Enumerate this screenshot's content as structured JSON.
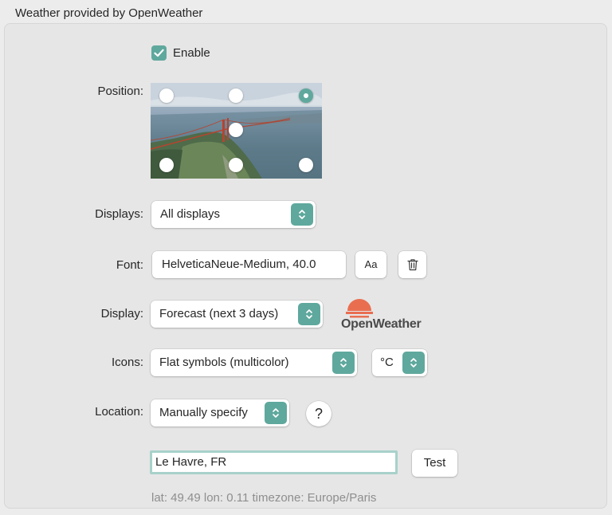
{
  "section_title": "Weather provided by OpenWeather",
  "enable": {
    "label": "Enable",
    "checked": true
  },
  "position": {
    "label": "Position:",
    "selected": "top-right",
    "options": [
      "top-left",
      "top-center",
      "top-right",
      "center",
      "bottom-left",
      "bottom-center",
      "bottom-right"
    ]
  },
  "displays": {
    "label": "Displays:",
    "value": "All displays"
  },
  "font": {
    "label": "Font:",
    "value": "HelveticaNeue-Medium, 40.0",
    "font_button": "Aa"
  },
  "display": {
    "label": "Display:",
    "value": "Forecast (next 3 days)"
  },
  "brand": {
    "name": "OpenWeather",
    "color": "#e96e50"
  },
  "icons": {
    "label": "Icons:",
    "value": "Flat symbols (multicolor)",
    "unit": "°C"
  },
  "location": {
    "label": "Location:",
    "value": "Manually specify",
    "help": "?",
    "city": "Le Havre, FR",
    "test_button": "Test",
    "info": "lat: 49.49 lon: 0.11 timezone: Europe/Paris"
  },
  "colors": {
    "accent": "#5fa89d",
    "focus_ring": "#a8d1cb"
  }
}
